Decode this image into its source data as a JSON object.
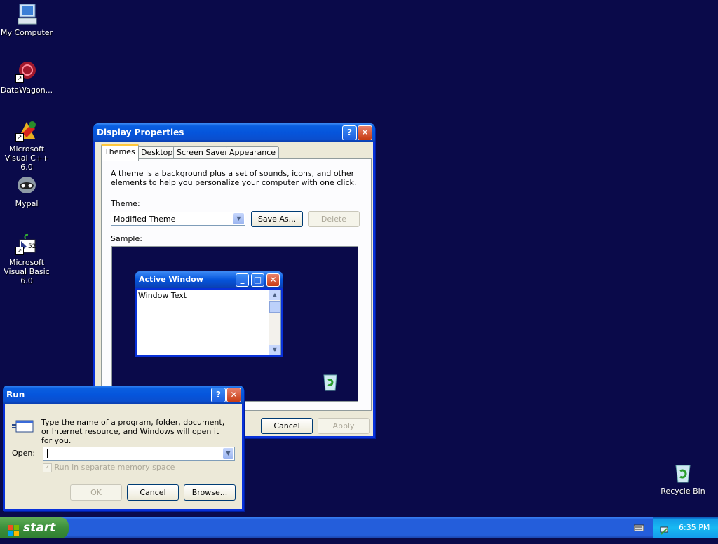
{
  "desktop": {
    "icons": [
      {
        "label": "My Computer"
      },
      {
        "label": "DataWagon..."
      },
      {
        "label": "Microsoft Visual C++ 6.0"
      },
      {
        "label": "Mypal"
      },
      {
        "label": "Microsoft Visual Basic 6.0"
      },
      {
        "label": "Recycle Bin"
      }
    ]
  },
  "display_properties": {
    "title": "Display Properties",
    "tabs": [
      "Themes",
      "Desktop",
      "Screen Saver",
      "Appearance"
    ],
    "description": "A theme is a background plus a set of sounds, icons, and other elements to help you personalize your computer with one click.",
    "theme_label": "Theme:",
    "theme_value": "Modified Theme",
    "save_as_label": "Save As...",
    "delete_label": "Delete",
    "sample_label": "Sample:",
    "sample_window_title": "Active Window",
    "sample_window_text": "Window Text",
    "cancel_label": "Cancel",
    "apply_label": "Apply"
  },
  "run_dialog": {
    "title": "Run",
    "description": "Type the name of a program, folder, document, or Internet resource, and Windows will open it for you.",
    "open_label": "Open:",
    "open_value": "",
    "checkbox_label": "Run in separate memory space",
    "ok_label": "OK",
    "cancel_label": "Cancel",
    "browse_label": "Browse..."
  },
  "taskbar": {
    "start_label": "start",
    "clock": "6:35 PM"
  },
  "colors": {
    "desktop": "#0a0a4a",
    "title_blue": "#0a5fe0",
    "close_red": "#c83c14",
    "start_green": "#3c8f3c"
  }
}
